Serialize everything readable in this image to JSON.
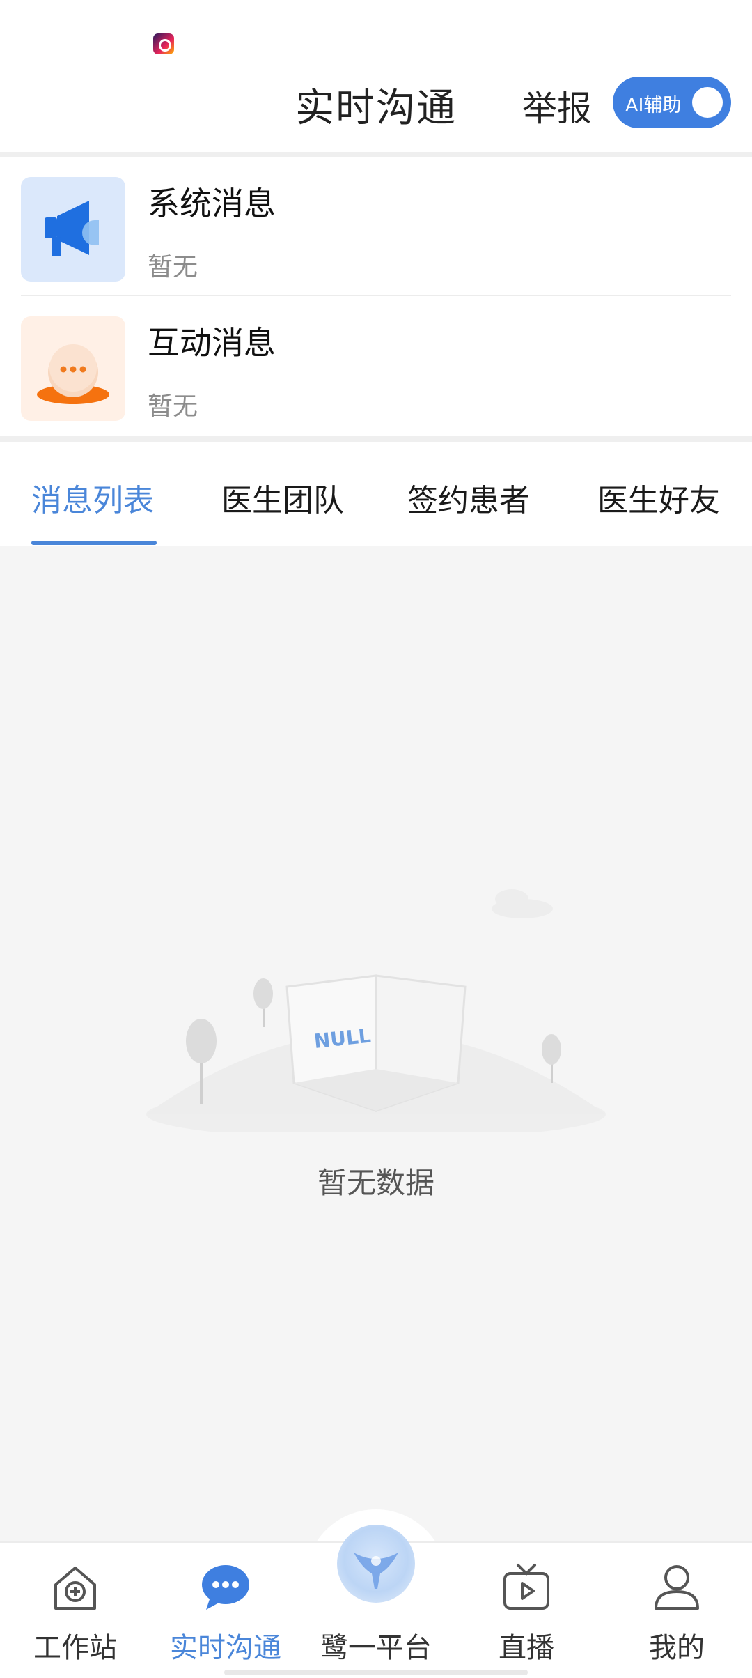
{
  "colors": {
    "accent": "#4a86d9",
    "toggle_bg": "#3f7fe0",
    "system_icon_bg": "#dbe8fb",
    "interact_icon_bg": "#fff0e6",
    "page_bg": "#f5f5f5"
  },
  "status_bar": {
    "app_icon": "notification-app-icon"
  },
  "header": {
    "title": "实时沟通",
    "report_label": "举报",
    "ai_toggle": {
      "label": "AI辅助",
      "on": true
    }
  },
  "notices": [
    {
      "title": "系统消息",
      "subtitle": "暂无",
      "icon": "megaphone-icon"
    },
    {
      "title": "互动消息",
      "subtitle": "暂无",
      "icon": "chat-bubble-icon"
    }
  ],
  "tabs": [
    {
      "label": "消息列表",
      "active": true
    },
    {
      "label": "医生团队",
      "active": false
    },
    {
      "label": "签约患者",
      "active": false
    },
    {
      "label": "医生好友",
      "active": false
    }
  ],
  "empty_state": {
    "illustration_text": "NULL",
    "text": "暂无数据"
  },
  "bottom_nav": [
    {
      "label": "工作站",
      "icon": "workstation-icon",
      "active": false
    },
    {
      "label": "实时沟通",
      "icon": "chat-icon",
      "active": true
    },
    {
      "label": "鹭一平台",
      "icon": "platform-logo-icon",
      "active": false
    },
    {
      "label": "直播",
      "icon": "live-tv-icon",
      "active": false
    },
    {
      "label": "我的",
      "icon": "profile-icon",
      "active": false
    }
  ]
}
